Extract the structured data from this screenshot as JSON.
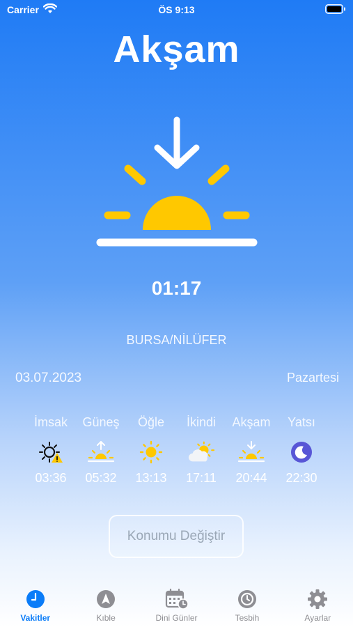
{
  "status_bar": {
    "carrier": "Carrier",
    "time": "ÖS 9:13"
  },
  "current_prayer": "Akşam",
  "remaining_time": "01:17",
  "location": "BURSA/NİLÜFER",
  "date": "03.07.2023",
  "weekday": "Pazartesi",
  "prayers": [
    {
      "name": "İmsak",
      "time": "03:36",
      "icon": "moon-sun-warning-icon"
    },
    {
      "name": "Güneş",
      "time": "05:32",
      "icon": "sunrise-icon"
    },
    {
      "name": "Öğle",
      "time": "13:13",
      "icon": "sun-icon"
    },
    {
      "name": "İkindi",
      "time": "17:11",
      "icon": "sun-cloud-icon"
    },
    {
      "name": "Akşam",
      "time": "20:44",
      "icon": "sunset-icon"
    },
    {
      "name": "Yatsı",
      "time": "22:30",
      "icon": "moon-icon"
    }
  ],
  "change_location_label": "Konumu Değiştir",
  "tabs": [
    {
      "label": "Vakitler",
      "icon": "clock-icon",
      "active": true
    },
    {
      "label": "Kıble",
      "icon": "compass-icon"
    },
    {
      "label": "Dini Günler",
      "icon": "calendar-icon"
    },
    {
      "label": "Tesbih",
      "icon": "timer-icon"
    },
    {
      "label": "Ayarlar",
      "icon": "gear-icon"
    }
  ],
  "colors": {
    "sun": "#ffc800",
    "accent": "#0a7cf8",
    "moon": "#5856d6",
    "tab_inactive": "#8e8e93"
  }
}
